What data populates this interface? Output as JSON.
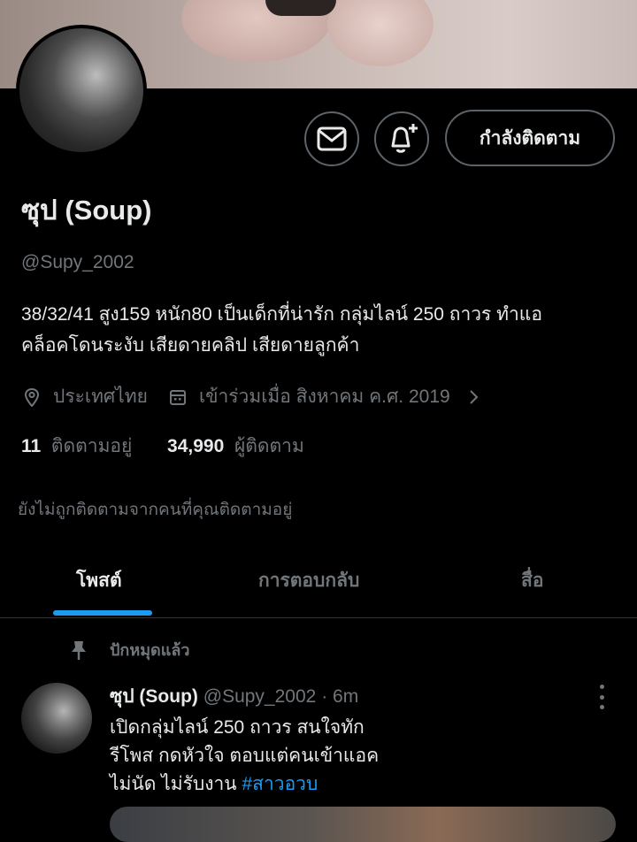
{
  "profile": {
    "display_name": "ซุป (Soup)",
    "handle": "@Supy_2002",
    "bio_line1": "38/32/41 สูง159 หนัก80  เป็นเด็กที่น่ารัก กลุ่มไลน์ 250 ถาวร ทำแอ",
    "bio_line2": "คล็อคโดนระงับ เสียดายคลิป เสียดายลูกค้า",
    "location": "ประเทศไทย",
    "joined": "เข้าร่วมเมื่อ สิงหาคม ค.ศ. 2019",
    "following_count": "11",
    "following_label": "ติดตามอยู่",
    "followers_count": "34,990",
    "followers_label": "ผู้ติดตาม",
    "not_followed_note": "ยังไม่ถูกติดตามจากคนที่คุณติดตามอยู่"
  },
  "actions": {
    "message_icon": "envelope-icon",
    "notify_icon": "bell-plus-icon",
    "follow_label": "กำลังติดตาม"
  },
  "tabs": [
    {
      "label": "โพสต์",
      "active": true
    },
    {
      "label": "การตอบกลับ",
      "active": false
    },
    {
      "label": "สื่อ",
      "active": false
    }
  ],
  "pinned_label": "ปักหมุดแล้ว",
  "tweet": {
    "author_name": "ซุป (Soup)",
    "author_handle": "@Supy_2002",
    "time": "· 6m",
    "line1": "เปิดกลุ่มไลน์ 250 ถาวร สนใจทัก",
    "line2": "รีโพส กดหัวใจ ตอบแต่คนเข้าแอค",
    "line3": "ไม่นัด ไม่รับงาน ",
    "hashtag": "#สาวอวบ"
  },
  "colors": {
    "background": "#000000",
    "text": "#e7e9ea",
    "muted": "#71767b",
    "accent": "#1d9bf0",
    "border": "#2f3336"
  }
}
